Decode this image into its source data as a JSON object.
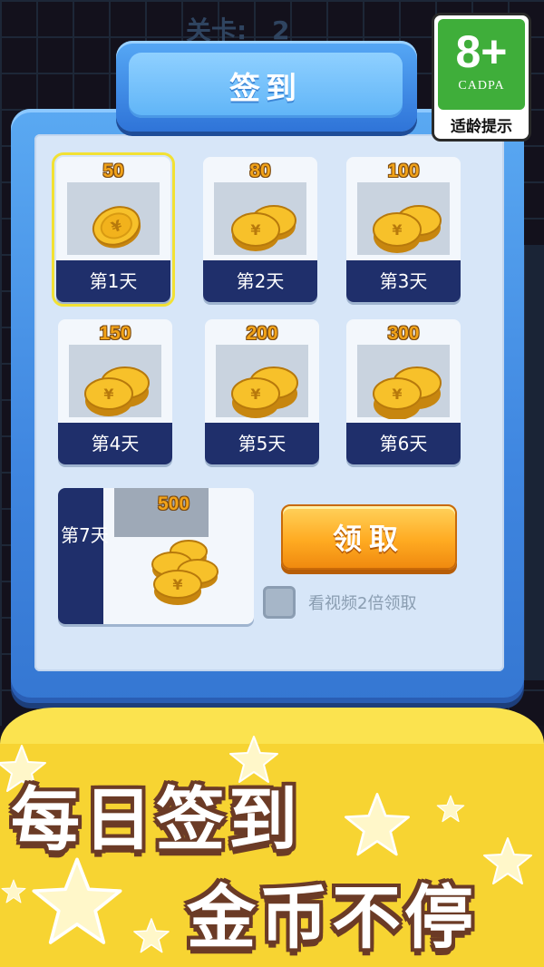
{
  "background": {
    "level_label": "关卡:",
    "level_number": "2"
  },
  "dialog": {
    "title": "签到"
  },
  "age_rating": {
    "rating": "8+",
    "org": "CADPA",
    "hint": "适龄提示"
  },
  "days": [
    {
      "amount": "50",
      "label": "第1天",
      "selected": true
    },
    {
      "amount": "80",
      "label": "第2天",
      "selected": false
    },
    {
      "amount": "100",
      "label": "第3天",
      "selected": false
    },
    {
      "amount": "150",
      "label": "第4天",
      "selected": false
    },
    {
      "amount": "200",
      "label": "第5天",
      "selected": false
    },
    {
      "amount": "300",
      "label": "第6天",
      "selected": false
    },
    {
      "amount": "500",
      "label": "第7天",
      "selected": false
    }
  ],
  "claim_button": {
    "label": "领取"
  },
  "video_option": {
    "label": "看视频2倍领取",
    "checked": false
  },
  "promo": {
    "line1": "每日签到",
    "line2": "金币不停"
  },
  "colors": {
    "panel_blue": "#3f86e0",
    "day_band_navy": "#1f2f6b",
    "coin_gold": "#f2b21c",
    "button_orange": "#ffab22",
    "promo_yellow": "#f7d432",
    "selected_outline": "#f2e134"
  }
}
